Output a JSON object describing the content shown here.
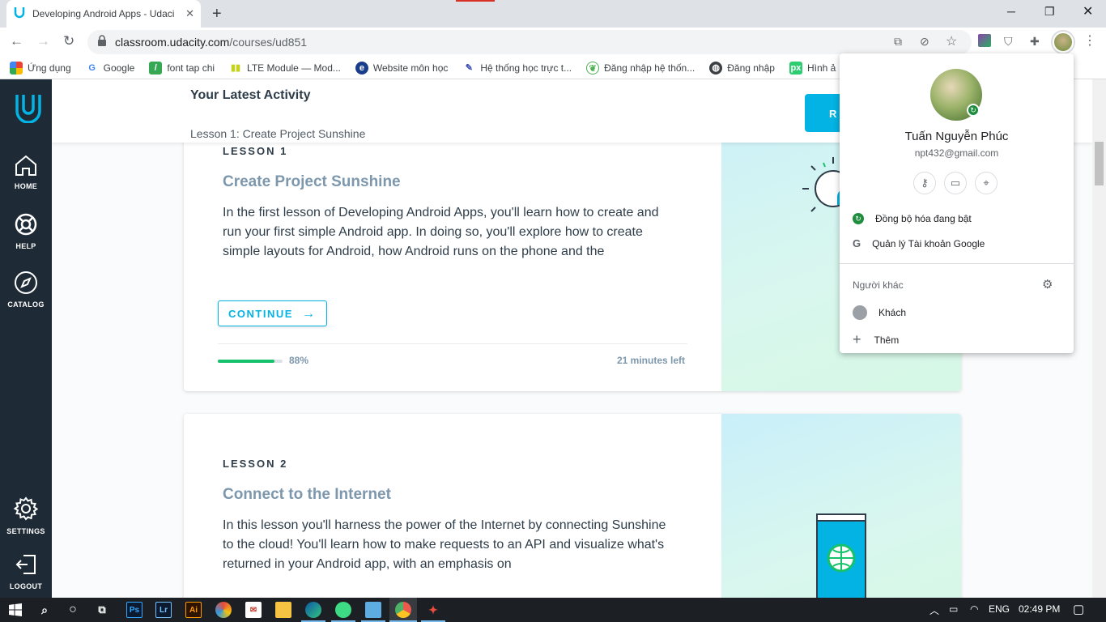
{
  "browser": {
    "tab_title": "Developing Android Apps - Udacity",
    "url_host": "classroom.udacity.com",
    "url_path": "/courses/ud851",
    "bookmarks": [
      {
        "label": "Ứng dụng",
        "icon": "apps-grid-icon"
      },
      {
        "label": "Google",
        "icon": "google-icon"
      },
      {
        "label": "font tap chi",
        "icon": "bookmark-green-icon"
      },
      {
        "label": "LTE Module — Mod...",
        "icon": "bars-icon"
      },
      {
        "label": "Website môn học",
        "icon": "globe-icon"
      },
      {
        "label": "Hệ thống học trực t...",
        "icon": "feather-icon"
      },
      {
        "label": "Đăng nhập hệ thốn...",
        "icon": "leaf-icon"
      },
      {
        "label": "Đăng nhập",
        "icon": "globe-dark-icon"
      },
      {
        "label": "Hình ả",
        "icon": "px-icon"
      }
    ]
  },
  "sidebar": {
    "home": "HOME",
    "help": "HELP",
    "catalog": "CATALOG",
    "settings": "SETTINGS",
    "logout": "LOGOUT"
  },
  "activity": {
    "title": "Your Latest Activity",
    "subtitle": "Lesson 1: Create Project Sunshine",
    "resume_label": "R"
  },
  "lessons": [
    {
      "number": "LESSON 1",
      "title": "Create Project Sunshine",
      "description": "In the first lesson of Developing Android Apps, you'll learn how to create and run your first simple Android app. In doing so, you'll explore how to create simple layouts for Android, how Android runs on the phone and the",
      "continue_label": "CONTINUE",
      "progress": 0.88,
      "progress_text": "88%",
      "time_left": "21 minutes left"
    },
    {
      "number": "LESSON 2",
      "title": "Connect to the Internet",
      "description": "In this lesson you'll harness the power of the Internet by connecting Sunshine to the cloud! You'll learn how to make requests to an API and visualize what's returned in your Android app, with an emphasis on"
    }
  ],
  "profile": {
    "name": "Tuấn Nguyễn Phúc",
    "email": "npt432@gmail.com",
    "sync": "Đồng bộ hóa đang bật",
    "manage": "Quản lý Tài khoản Google",
    "other_people": "Người khác",
    "guest": "Khách",
    "add": "Thêm"
  },
  "taskbar": {
    "language": "ENG",
    "time": "02:49 PM"
  },
  "colors": {
    "udacity_blue": "#02b3e4",
    "sidebar_bg": "#1e2a35",
    "progress_green": "#15c26b",
    "sync_green": "#1e8e3e"
  }
}
